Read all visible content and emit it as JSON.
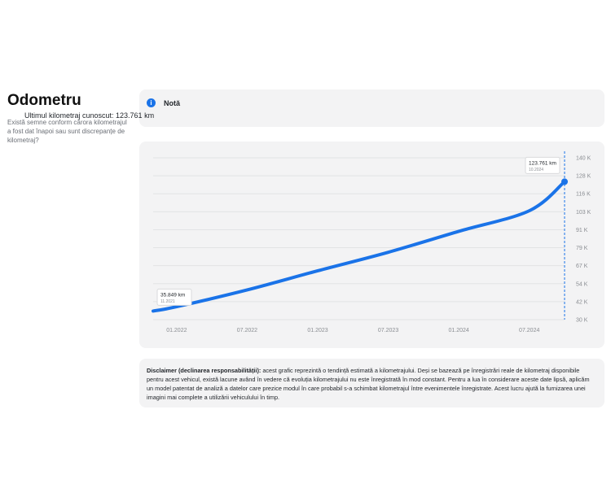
{
  "header": {
    "title": "Odometru",
    "question": "Există semne conform cărora kilometrajul a fost dat înapoi sau sunt discrepanțe de kilometraj?"
  },
  "note": {
    "title": "Notă",
    "text": "Ultimul kilometraj cunoscut: 123.761 km",
    "icon": "info-icon"
  },
  "chart_data": {
    "type": "line",
    "x": [
      "11.2021",
      "01.2022",
      "07.2022",
      "01.2023",
      "07.2023",
      "01.2024",
      "07.2024",
      "10.2024"
    ],
    "y": [
      35849,
      38800,
      50200,
      63200,
      75800,
      90000,
      104000,
      123761
    ],
    "x_ticks": [
      "01.2022",
      "07.2022",
      "01.2023",
      "07.2023",
      "01.2024",
      "07.2024"
    ],
    "y_ticks": [
      "140 K",
      "128 K",
      "116 K",
      "103 K",
      "91 K",
      "79 K",
      "67 K",
      "54 K",
      "42 K",
      "30 K"
    ],
    "ylim": [
      30000,
      140000
    ],
    "start_label": {
      "value": "35.849 km",
      "date": "11.2021"
    },
    "end_label": {
      "value": "123.761 km",
      "date": "10.2024"
    },
    "grid": true,
    "line_color": "#1a73e8"
  },
  "disclaimer": {
    "label": "Disclaimer (declinarea responsabilității):",
    "text": " acest grafic reprezintă o tendință estimată a kilometrajului. Deși se bazează pe înregistrări reale de kilometraj disponibile pentru acest vehicul, există lacune având în vedere că evoluția kilometrajului nu este înregistrată în mod constant. Pentru a lua în considerare aceste date lipsă, aplicăm un model patentat de analiză a datelor care prezice modul în care probabil s-a schimbat kilometrajul între evenimentele înregistrate. Acest lucru ajută la furnizarea unei imagini mai complete a utilizării vehiculului în timp."
  }
}
